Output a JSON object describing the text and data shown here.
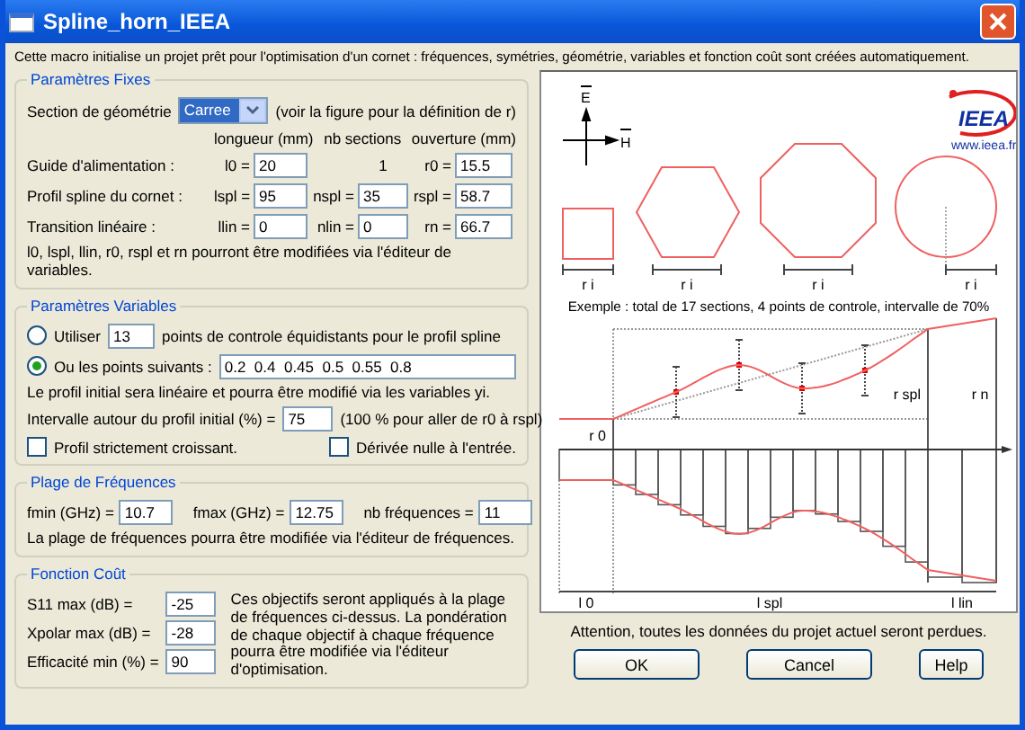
{
  "window": {
    "title": "Spline_horn_IEEA"
  },
  "intro": "Cette macro initialise un projet prêt pour l'optimisation d'un cornet : fréquences, symétries, géométrie, variables et fonction coût sont créées automatiquement.",
  "fixed": {
    "title": "Paramètres Fixes",
    "geometry": {
      "label": "Section de géométrie",
      "value": "Carree",
      "note": "(voir la figure pour la définition de r)"
    },
    "headers": [
      "longueur (mm)",
      "nb sections",
      "ouverture (mm)"
    ],
    "rows": [
      {
        "label": "Guide d'alimentation :",
        "cells": [
          {
            "kind": "input",
            "prefix": "l0 =",
            "value": "20"
          },
          {
            "kind": "text",
            "value": "1"
          },
          {
            "kind": "input",
            "prefix": "r0 =",
            "value": "15.5"
          }
        ]
      },
      {
        "label": "Profil spline du cornet :",
        "cells": [
          {
            "kind": "input",
            "prefix": "lspl =",
            "value": "95"
          },
          {
            "kind": "input",
            "prefix": "nspl =",
            "value": "35"
          },
          {
            "kind": "input",
            "prefix": "rspl =",
            "value": "58.7"
          }
        ]
      },
      {
        "label": "Transition linéaire :",
        "cells": [
          {
            "kind": "input",
            "prefix": "llin =",
            "value": "0"
          },
          {
            "kind": "input",
            "prefix": "nlin =",
            "value": "0"
          },
          {
            "kind": "input",
            "prefix": "rn =",
            "value": "66.7"
          }
        ]
      }
    ],
    "note": "l0, lspl, llin, r0, rspl et rn pourront être modifiées via l'éditeur de variables."
  },
  "variables": {
    "title": "Paramètres Variables",
    "options": [
      {
        "kind": "count",
        "selected": false,
        "label": "Utiliser",
        "value": "13",
        "suffix": "points de controle équidistants pour le profil spline"
      },
      {
        "kind": "list",
        "selected": true,
        "label": "Ou les points suivants :",
        "value": "0.2  0.4  0.45  0.5  0.55  0.8"
      }
    ],
    "note": "Le profil initial sera linéaire et pourra être modifié via les variables yi.",
    "interval": {
      "label": "Intervalle autour du profil initial (%) =",
      "value": "75",
      "note": "(100 % pour aller de r0 à rspl)"
    },
    "checkboxes": [
      {
        "label": "Profil strictement croissant.",
        "checked": false
      },
      {
        "label": "Dérivée nulle à l'entrée.",
        "checked": false
      }
    ]
  },
  "frequencies": {
    "title": "Plage de Fréquences",
    "fields": [
      {
        "label": "fmin (GHz) =",
        "value": "10.7"
      },
      {
        "label": "fmax (GHz) =",
        "value": "12.75"
      },
      {
        "label": "nb fréquences =",
        "value": "11"
      }
    ],
    "note": "La plage de fréquences pourra être modifiée via l'éditeur de fréquences."
  },
  "cost": {
    "title": "Fonction Coût",
    "fields": [
      {
        "label": "S11 max (dB) =",
        "value": "-25"
      },
      {
        "label": "Xpolar max (dB) =",
        "value": "-28"
      },
      {
        "label": "Efficacité min (%) =",
        "value": "90"
      }
    ],
    "note": "Ces objectifs seront appliqués à la plage de fréquences ci-dessus. La pondération de chaque objectif à chaque fréquence pourra être modifiée via l'éditeur d'optimisation."
  },
  "diagram": {
    "axis_labels": [
      "E",
      "H"
    ],
    "logo": "IEEA",
    "url": "www.ieea.fr",
    "section_labels": [
      "r i",
      "r i",
      "r i",
      "r i"
    ],
    "caption": "Exemple : total de 17 sections, 4 points de controle, intervalle de 70%",
    "radius_labels": [
      "r 0",
      "r spl",
      "r n"
    ],
    "length_labels": [
      "l 0",
      "l spl",
      "l lin"
    ]
  },
  "warning": "Attention, toutes les données du projet actuel seront perdues.",
  "buttons": [
    "OK",
    "Cancel",
    "Help"
  ]
}
